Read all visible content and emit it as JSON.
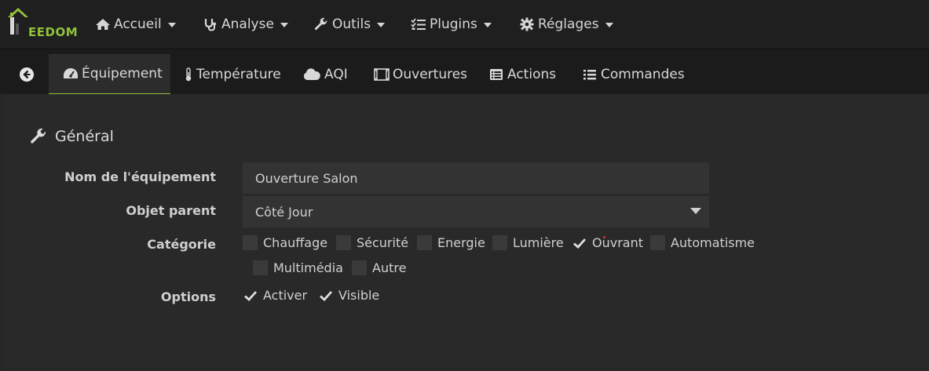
{
  "brand": {
    "logo_text": "EEDOM",
    "accent": "#92c13c"
  },
  "navbar": {
    "items": [
      {
        "icon": "home-icon",
        "label": "Accueil"
      },
      {
        "icon": "stethoscope-icon",
        "label": "Analyse"
      },
      {
        "icon": "wrench-icon",
        "label": "Outils"
      },
      {
        "icon": "tasks-icon",
        "label": "Plugins"
      },
      {
        "icon": "gear-icon",
        "label": "Réglages"
      }
    ]
  },
  "tabs": [
    {
      "icon": "tachometer-icon",
      "label": "Équipement",
      "active": true
    },
    {
      "icon": "thermometer-icon",
      "label": "Température"
    },
    {
      "icon": "cloud-icon",
      "label": "AQI"
    },
    {
      "icon": "window-icon",
      "label": "Ouvertures"
    },
    {
      "icon": "list-alt-icon",
      "label": "Actions"
    },
    {
      "icon": "list-icon",
      "label": "Commandes"
    }
  ],
  "section": {
    "icon": "wrench-icon",
    "title": "Général"
  },
  "form": {
    "name_label": "Nom de l'équipement",
    "name_value": "Ouverture Salon",
    "parent_label": "Objet parent",
    "parent_value": "Côté Jour",
    "category_label": "Catégorie",
    "categories": [
      {
        "label": "Chauffage",
        "checked": false
      },
      {
        "label": "Sécurité",
        "checked": false
      },
      {
        "label": "Energie",
        "checked": false
      },
      {
        "label": "Lumière",
        "checked": false
      },
      {
        "label": "Ouvrant",
        "checked": true
      },
      {
        "label": "Automatisme",
        "checked": false
      },
      {
        "label": "Multimédia",
        "checked": false
      },
      {
        "label": "Autre",
        "checked": false
      }
    ],
    "options_label": "Options",
    "options": [
      {
        "label": "Activer",
        "checked": true
      },
      {
        "label": "Visible",
        "checked": true
      }
    ]
  }
}
